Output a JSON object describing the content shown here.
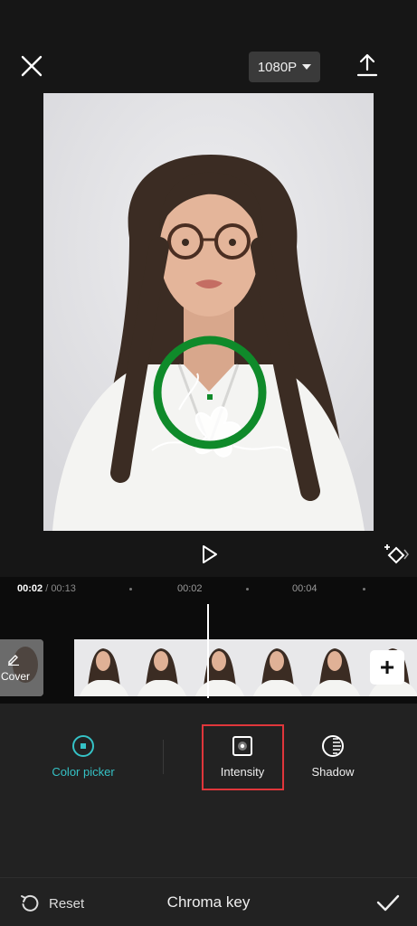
{
  "header": {
    "resolution": "1080P"
  },
  "timeline": {
    "current_time": "00:02",
    "total_time": "/ 00:13",
    "ticks": [
      "00:02",
      "00:04"
    ],
    "cover_label": "Cover"
  },
  "tools": {
    "items": [
      {
        "label": "Color picker",
        "active": true
      },
      {
        "label": "Intensity",
        "active": false
      },
      {
        "label": "Shadow",
        "active": false
      }
    ]
  },
  "footer": {
    "reset_label": "Reset",
    "title": "Chroma key"
  },
  "colors": {
    "accent": "#35c2c6",
    "picker_ring": "#0f8a2a",
    "highlight": "#e0363b"
  }
}
